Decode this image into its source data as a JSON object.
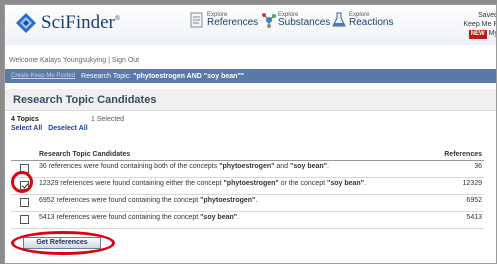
{
  "app": {
    "logo_text": "SciFinder",
    "logo_mark": "®"
  },
  "nav": [
    {
      "small": "Explore",
      "big": "References"
    },
    {
      "small": "Explore",
      "big": "Substances"
    },
    {
      "small": "Explore",
      "big": "Reactions"
    }
  ],
  "saved": {
    "line1": "Saved",
    "line2": "Keep Me P",
    "badge": "NEW",
    "line3": "My"
  },
  "welcome": {
    "text": "Welcome Kalays Youngsukying",
    "sep": "|",
    "signout": "Sign Out"
  },
  "crumb": {
    "tab": "Create Keep Me Posted",
    "prefix": "Research Topic",
    "query": "\"phytoestrogen AND \"soy bean\"\""
  },
  "section_title": "Research Topic Candidates",
  "counts": {
    "topics": "4 Topics",
    "selected": "1 Selected"
  },
  "select_all": "Select All",
  "deselect_all": "Deselect All",
  "table": {
    "header_candidates": "Research Topic Candidates",
    "header_refs": "References",
    "rows": [
      {
        "pre": "36 references were found containing both of the concepts ",
        "c1": "\"phytoestrogen\"",
        "mid": " and ",
        "c2": "\"soy bean\"",
        "post": ".",
        "refs": "36",
        "checked": false
      },
      {
        "pre": "12329 references were found containing either the concept ",
        "c1": "\"phytoestrogen\"",
        "mid": " or the concept ",
        "c2": "\"soy bean\"",
        "post": ".",
        "refs": "12329",
        "checked": true
      },
      {
        "pre": "6952 references were found containing the concept ",
        "c1": "\"phytoestrogen\"",
        "mid": "",
        "c2": "",
        "post": ".",
        "refs": "6952",
        "checked": false
      },
      {
        "pre": "5413 references were found containing the concept ",
        "c1": "\"soy bean\"",
        "mid": "",
        "c2": "",
        "post": ".",
        "refs": "5413",
        "checked": false
      }
    ]
  },
  "get_refs": "Get References"
}
